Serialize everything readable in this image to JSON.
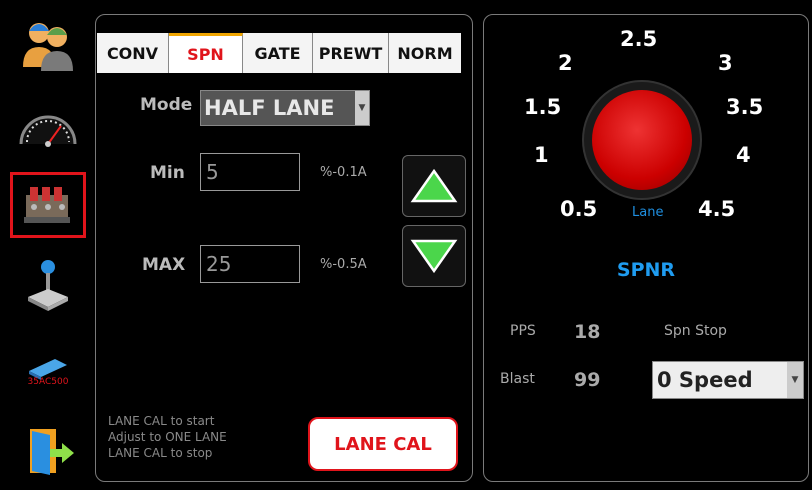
{
  "sidebar": {
    "items": [
      {
        "name": "users",
        "selected": false
      },
      {
        "name": "speedometer",
        "selected": false
      },
      {
        "name": "valve-block",
        "selected": true
      },
      {
        "name": "joystick",
        "selected": false
      },
      {
        "name": "controller",
        "label": "35AC500",
        "selected": false
      },
      {
        "name": "exit",
        "selected": false
      }
    ]
  },
  "tabs": [
    {
      "label": "CONV",
      "active": false
    },
    {
      "label": "SPN",
      "active": true
    },
    {
      "label": "GATE",
      "active": false
    },
    {
      "label": "PREWT",
      "active": false
    },
    {
      "label": "NORM",
      "active": false
    }
  ],
  "mode": {
    "label": "Mode",
    "value": "HALF LANE"
  },
  "min": {
    "label": "Min",
    "value": "5",
    "unit": "%-0.1A"
  },
  "max": {
    "label": "MAX",
    "value": "25",
    "unit": "%-0.5A"
  },
  "hint": {
    "line1": "LANE CAL to start",
    "line2": "Adjust to ONE LANE",
    "line3": "LANE CAL to stop"
  },
  "lane_cal_label": "LANE CAL",
  "dial": {
    "label": "Lane",
    "ticks": [
      "0.5",
      "1",
      "1.5",
      "2",
      "2.5",
      "3",
      "3.5",
      "4",
      "4.5"
    ]
  },
  "spnr_title": "SPNR",
  "stats": {
    "pps_label": "PPS",
    "pps_value": "18",
    "blast_label": "Blast",
    "blast_value": "99",
    "spn_stop_label": "Spn Stop",
    "speed_select": "0 Speed"
  },
  "colors": {
    "accent_red": "#e0141b",
    "accent_blue": "#1f9cf0",
    "knob_red": "#cc0000",
    "arrow_green": "#4bd64b"
  }
}
